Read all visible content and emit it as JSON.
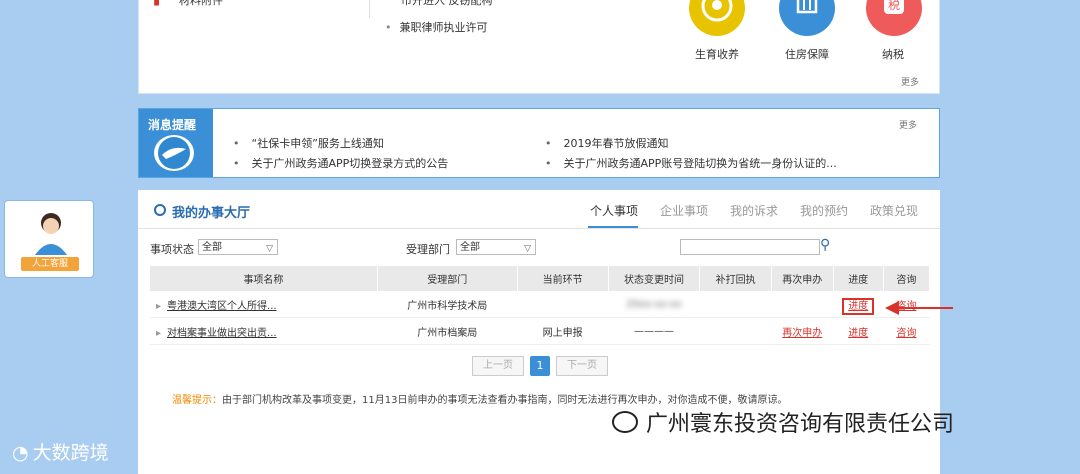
{
  "top": {
    "left_item": "材料附件",
    "middle_cut_item": "市开进入 反窃配构",
    "middle_item": "兼职律师执业许可",
    "services": [
      {
        "label": "生育收养",
        "icon": "baby-icon",
        "color": "#e8c400"
      },
      {
        "label": "住房保障",
        "icon": "building-icon",
        "color": "#3b8fd6"
      },
      {
        "label": "纳税",
        "icon": "tax-icon",
        "color": "#ef5b5b"
      }
    ],
    "more": "更多"
  },
  "notice": {
    "title": "消息提醒",
    "more": "更多",
    "items": [
      "“社保卡申领”服务上线通知",
      "2019年春节放假通知",
      "关于广州政务通APP切换登录方式的公告",
      "关于广州政务通APP账号登陆切换为省统一身份认证的..."
    ]
  },
  "hall": {
    "title": "我的办事大厅",
    "tabs": [
      "个人事项",
      "企业事项",
      "我的诉求",
      "我的预约",
      "政策兑现"
    ],
    "filters": {
      "status_label": "事项状态",
      "status_value": "全部",
      "dept_label": "受理部门",
      "dept_value": "全部",
      "search_placeholder": ""
    },
    "columns": [
      "事项名称",
      "受理部门",
      "当前环节",
      "状态变更时间",
      "补打回执",
      "再次申办",
      "进度",
      "咨询"
    ],
    "rows": [
      {
        "name": "粤港澳大湾区个人所得...",
        "dept": "广州市科学技术局",
        "stage": "",
        "time": "20xx-xx-xx",
        "receipt": "",
        "reapply": "",
        "progress": "进度",
        "consult": "咨询"
      },
      {
        "name": "对档案事业做出突出贡...",
        "dept": "广州市档案局",
        "stage": "网上申报",
        "time": "————",
        "receipt": "",
        "reapply": "再次申办",
        "progress": "进度",
        "consult": "咨询"
      }
    ],
    "pager": {
      "prev": "上一页",
      "current": "1",
      "next": "下一页"
    },
    "tip_label": "温馨提示：",
    "tip_text": "由于部门机构改革及事项变更，11月13日前申办的事项无法查看办事指南，同时无法进行再次申办，对你造成不便，敬请原谅。"
  },
  "customer_service": {
    "label": "人工客服"
  },
  "watermarks": {
    "company": "广州寰东投资咨询有限责任公司",
    "left": "大数跨境"
  }
}
